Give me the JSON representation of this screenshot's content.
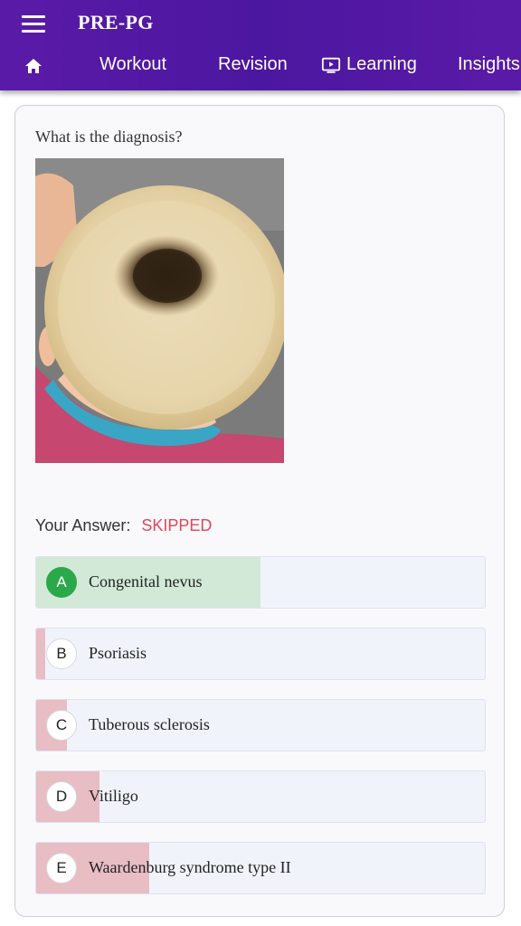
{
  "app": {
    "title": "PRE-PG"
  },
  "nav": {
    "home_icon": "home-icon",
    "tabs": [
      {
        "label": "Workout"
      },
      {
        "label": "Revision"
      },
      {
        "label": "Learning",
        "icon": "tv-play-icon"
      },
      {
        "label": "Insights"
      }
    ]
  },
  "question": {
    "text": "What is the diagnosis?",
    "image": "photo of child's blonde hair with a dark brown patch at the crown"
  },
  "answer": {
    "label": "Your Answer:",
    "value": "SKIPPED"
  },
  "colors": {
    "appbar": "#4c17a0",
    "correct": "#2aa84a",
    "correct_fill": "#d2e9d8",
    "wrong_fill": "#e8bdc4",
    "skipped": "#e0475a"
  },
  "options": [
    {
      "letter": "A",
      "text": "Congenital nevus",
      "correct": true,
      "share": 0.5
    },
    {
      "letter": "B",
      "text": "Psoriasis",
      "correct": false,
      "share": 0.02
    },
    {
      "letter": "C",
      "text": "Tuberous sclerosis",
      "correct": false,
      "share": 0.07
    },
    {
      "letter": "D",
      "text": "Vitiligo",
      "correct": false,
      "share": 0.14
    },
    {
      "letter": "E",
      "text": "Waardenburg syndrome type II",
      "correct": false,
      "share": 0.25
    }
  ]
}
